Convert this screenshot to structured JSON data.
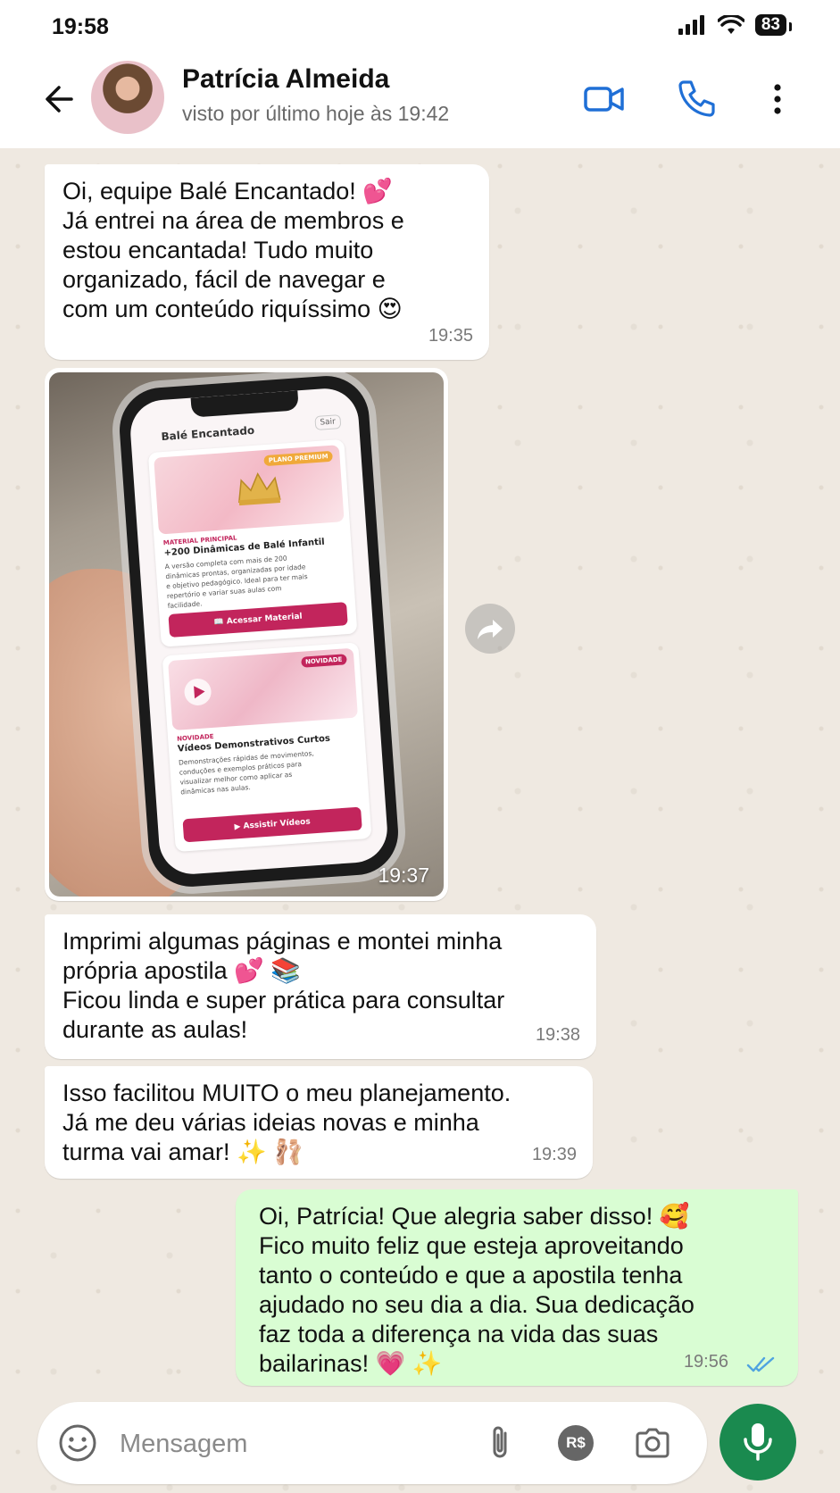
{
  "status_bar": {
    "time": "19:58",
    "battery": "83",
    "icons": [
      "signal-icon",
      "wifi-icon",
      "battery-icon"
    ]
  },
  "header": {
    "contact_name": "Patrícia Almeida",
    "last_seen": "visto por último hoje às 19:42",
    "icons": [
      "back-arrow-icon",
      "video-call-icon",
      "phone-call-icon",
      "more-options-icon"
    ]
  },
  "colors": {
    "accent": "#1f6fd6",
    "outgoing_bubble": "#d9fdd3",
    "mic_button": "#1a8a4f",
    "brand_pink": "#c2255c"
  },
  "messages": [
    {
      "direction": "in",
      "text": "Oi, equipe Balé Encantado! 💕\nJá entrei na área de membros e\nestou encantada! Tudo muito\norganizado, fácil de navegar e\ncom um conteúdo riquíssimo 😍",
      "time": "19:35"
    },
    {
      "direction": "in",
      "type": "image",
      "time": "19:37",
      "image_content": {
        "app_title": "Balé Encantado",
        "exit_label": "Sair",
        "card1": {
          "badge": "PLANO PREMIUM",
          "kicker": "MATERIAL PRINCIPAL",
          "title": "+200 Dinâmicas de Balé Infantil",
          "description": "A versão completa com mais de 200\ndinâmicas prontas, organizadas por idade\ne objetivo pedagógico. Ideal para ter mais\nrepertório e variar suas aulas com\nfacilidade.",
          "button": "📖 Acessar Material"
        },
        "card2": {
          "badge": "NOVIDADE",
          "kicker": "NOVIDADE",
          "title": "Vídeos Demonstrativos Curtos",
          "description": "Demonstrações rápidas de movimentos,\nconduções e exemplos práticos para\nvisualizar melhor como aplicar as\ndinâmicas nas aulas.",
          "button": "▶ Assistir Vídeos"
        }
      }
    },
    {
      "direction": "in",
      "text": "Imprimi algumas páginas e montei minha\nprópria apostila 💕 📚\nFicou linda e super prática para consultar\ndurante as aulas!",
      "time": "19:38"
    },
    {
      "direction": "in",
      "text": "Isso facilitou MUITO o meu planejamento.\nJá me deu várias ideias novas e minha\nturma vai amar! ✨ 🩰",
      "time": "19:39"
    },
    {
      "direction": "out",
      "text": "Oi, Patrícia! Que alegria saber disso! 🥰\nFico muito feliz que esteja aproveitando\ntanto o conteúdo e que a apostila tenha\najudado no seu dia a dia. Sua dedicação\nfaz toda a diferença na vida das suas\nbailarinas! 💗 ✨",
      "time": "19:56",
      "read_receipt": "double-check-icon"
    }
  ],
  "composer": {
    "placeholder": "Mensagem",
    "icons": [
      "emoji-icon",
      "attach-icon",
      "payment-icon",
      "camera-icon",
      "mic-icon"
    ],
    "payment_label": "R$"
  }
}
